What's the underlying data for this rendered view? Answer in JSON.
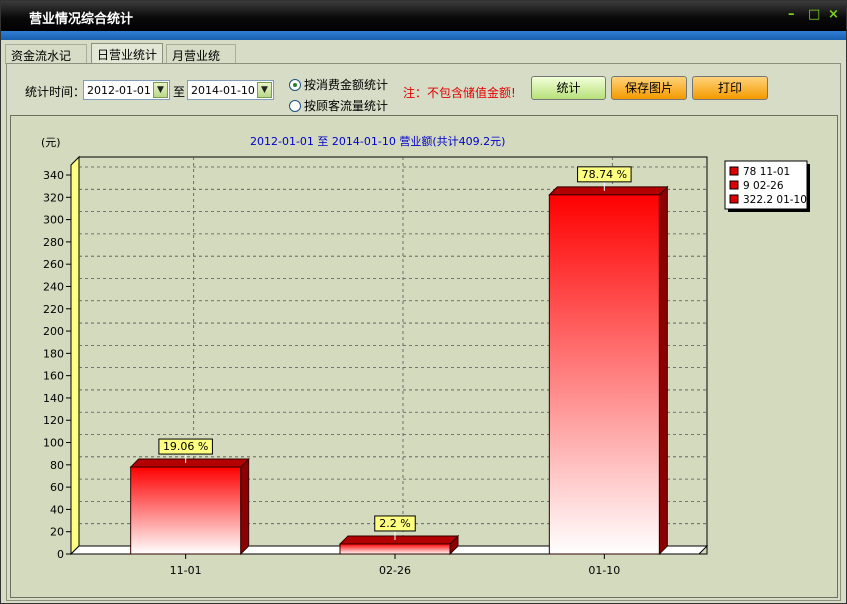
{
  "window": {
    "title": "营业情况综合统计",
    "min_glyph": "–",
    "max_glyph": "□",
    "close_glyph": "×"
  },
  "tabs": [
    {
      "label": "资金流水记录"
    },
    {
      "label": "日营业统计"
    },
    {
      "label": "月营业统计"
    }
  ],
  "filters": {
    "time_label": "统计时间：",
    "start_date": "2012-01-01",
    "to_label": "至",
    "end_date": "2014-01-10",
    "radio_amount": "按消费金额统计",
    "radio_customers": "按顾客流量统计",
    "note": "注：不包含储值金额!"
  },
  "buttons": {
    "stats": "统计",
    "save_image": "保存图片",
    "print": "打印"
  },
  "chart_data": {
    "type": "bar",
    "title": "2012-01-01 至 2014-01-10 营业额(共计409.2元)",
    "ylabel": "(元)",
    "categories": [
      "11-01",
      "02-26",
      "01-10"
    ],
    "values": [
      78,
      9,
      322.2
    ],
    "percent_labels": [
      "19.06 %",
      "2.2 %",
      "78.74 %"
    ],
    "legend": [
      "78   11-01",
      "9   02-26",
      "322.2   01-10"
    ],
    "ylim": [
      0,
      340
    ],
    "yticks": [
      "0",
      "20",
      "40",
      "60",
      "80",
      "100",
      "120",
      "140",
      "160",
      "180",
      "200",
      "220",
      "240",
      "260",
      "280",
      "300",
      "320",
      "340"
    ],
    "grid": true,
    "legend_position": "top-right",
    "bar_color": "#e00000"
  }
}
